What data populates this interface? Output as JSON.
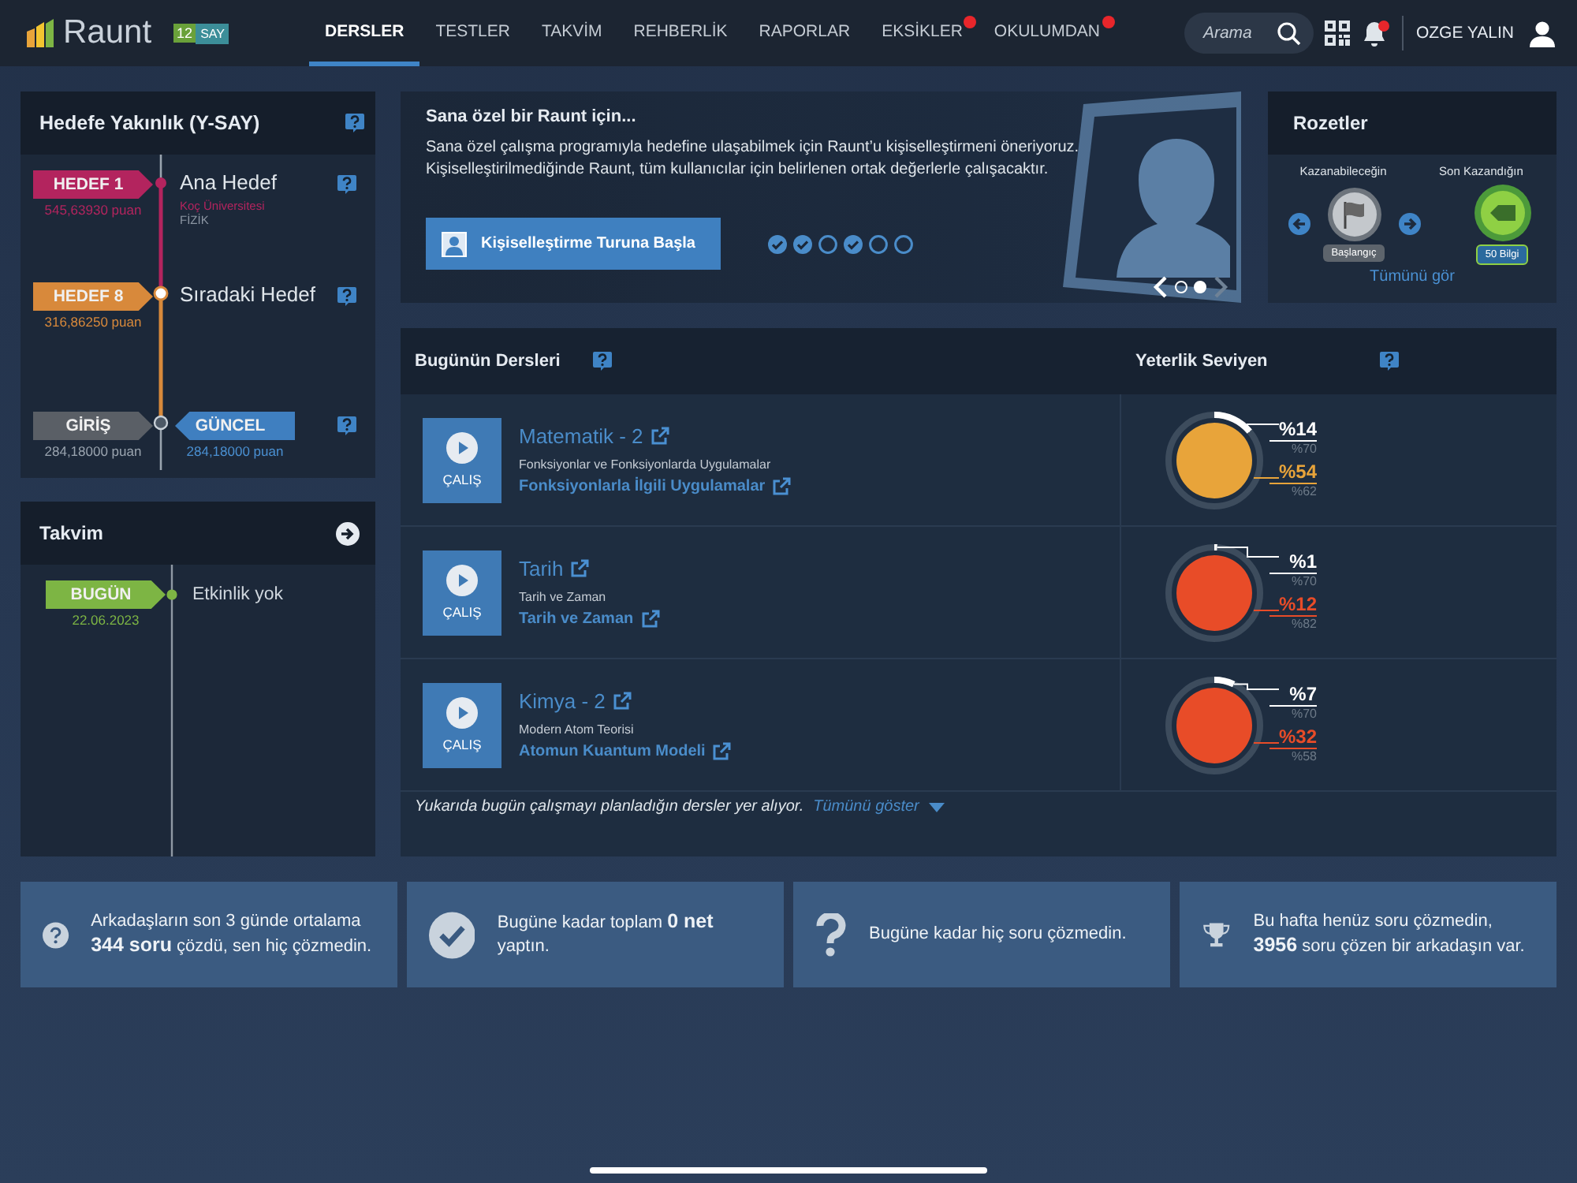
{
  "nav": {
    "brand": "Raunt",
    "grade": "12",
    "track": "SAY",
    "items": [
      {
        "label": "DERSLER",
        "selected": true,
        "alert": false
      },
      {
        "label": "TESTLER",
        "selected": false,
        "alert": false
      },
      {
        "label": "TAKVİM",
        "selected": false,
        "alert": false
      },
      {
        "label": "REHBERLİK",
        "selected": false,
        "alert": false
      },
      {
        "label": "RAPORLAR",
        "selected": false,
        "alert": false
      },
      {
        "label": "EKSİKLER",
        "selected": false,
        "alert": true
      },
      {
        "label": "OKULUMDAN",
        "selected": false,
        "alert": true
      }
    ],
    "search": {
      "placeholder": "Arama"
    },
    "notifications": {
      "alert": true
    },
    "user": "OZGE YALIN"
  },
  "goal": {
    "title": "Hedefe Yakınlık (Y-SAY)",
    "targets": [
      {
        "tag": "HEDEF 1",
        "score": "545,63930 puan",
        "color": "#b3245e",
        "name": "Ana Hedef",
        "school": "Koç Üniversitesi",
        "department": "FİZİK"
      },
      {
        "tag": "HEDEF 8",
        "score": "316,86250 puan",
        "color": "#d8893b",
        "name": "Sıradaki Hedef"
      }
    ],
    "start": {
      "tag": "GİRİŞ",
      "score": "284,18000 puan"
    },
    "current": {
      "tag": "GÜNCEL",
      "score": "284,18000 puan"
    }
  },
  "calendar": {
    "title": "Takvim",
    "today": {
      "tag": "BUGÜN",
      "date": "22.06.2023"
    },
    "empty": "Etkinlik yok"
  },
  "promo": {
    "title": "Sana özel bir Raunt için...",
    "text": "Sana özel çalışma programıyla hedefine ulaşabilmek için Raunt’u kişiselleştirmeni öneriyoruz. Kişiselleştirilmediğinde Raunt, tüm kullanıcılar için belirlenen ortak değerlerle çalışacaktır.",
    "button": "Kişiselleştirme Turuna Başla",
    "steps": [
      {
        "done": true
      },
      {
        "done": true
      },
      {
        "done": false
      },
      {
        "done": true
      },
      {
        "done": false
      },
      {
        "done": false
      }
    ],
    "slides": [
      {
        "selected": false
      },
      {
        "selected": true
      }
    ]
  },
  "badges": {
    "title": "Rozetler",
    "next_label": "Kazanabileceğin",
    "last_label": "Son Kazandığın",
    "next_badge": "Başlangıç",
    "last_badge": "50 Bilgi",
    "link": "Tümünü gör"
  },
  "lessons": {
    "title": "Bugünün Dersleri",
    "level_title": "Yeterlik Seviyen",
    "rows": [
      {
        "button": "ÇALIŞ",
        "subject": "Matematik - 2",
        "topic": "Fonksiyonlar ve Fonksiyonlarda Uygulamalar",
        "subtopic": "Fonksiyonlarla İlgili Uygulamalar",
        "level": 0.14,
        "percent": "%14",
        "percent_target": "%70",
        "score": "%54",
        "score_target": "%62",
        "color": "#e8a43a"
      },
      {
        "button": "ÇALIŞ",
        "subject": "Tarih",
        "topic": "Tarih ve Zaman",
        "subtopic": "Tarih ve Zaman",
        "level": 0.01,
        "percent": "%1",
        "percent_target": "%70",
        "score": "%12",
        "score_target": "%82",
        "color": "#e84c28"
      },
      {
        "button": "ÇALIŞ",
        "subject": "Kimya - 2",
        "topic": "Modern Atom Teorisi",
        "subtopic": "Atomun Kuantum Modeli",
        "level": 0.07,
        "percent": "%7",
        "percent_target": "%70",
        "score": "%32",
        "score_target": "%58",
        "color": "#e84c28"
      }
    ],
    "note": "Yukarıda bugün çalışmayı planladığın dersler yer alıyor.",
    "show_all": "Tümünü göster"
  },
  "stats": [
    {
      "kind": "question-circle",
      "text": "Arkadaşların son 3 günde ortalama **344 soru** çözdü, sen hiç çözmedin."
    },
    {
      "kind": "check",
      "text": "Bugüne kadar toplam **0 net** yaptın."
    },
    {
      "kind": "question",
      "text": "Bugüne kadar hiç soru çözmedin."
    },
    {
      "kind": "trophy",
      "text": "Bu hafta henüz soru çözmedin, **3956** soru çözen bir arkadaşın var."
    }
  ]
}
